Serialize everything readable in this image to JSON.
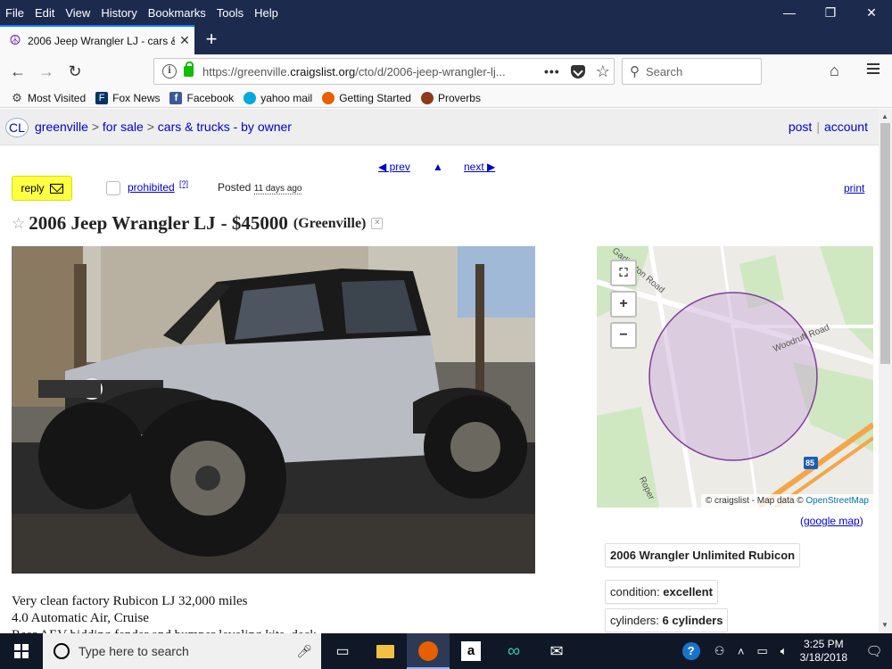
{
  "menu": [
    "File",
    "Edit",
    "View",
    "History",
    "Bookmarks",
    "Tools",
    "Help"
  ],
  "window_controls": {
    "minimize": "—",
    "restore": "❐",
    "close": "✕"
  },
  "tab": {
    "title": "2006 Jeep Wrangler LJ - cars & t",
    "close": "✕"
  },
  "newtab": "+",
  "nav": {
    "back": "←",
    "forward": "→",
    "reload": "↻"
  },
  "url": {
    "prefix": "https://greenville.",
    "domain": "craigslist.org",
    "path": "/cto/d/2006-jeep-wrangler-lj..."
  },
  "search": {
    "placeholder": "Search"
  },
  "bookmarks": [
    {
      "label": "Most Visited",
      "icon": "gear-icon",
      "color": "#444"
    },
    {
      "label": "Fox News",
      "icon": "foxnews-icon",
      "color": "#003366"
    },
    {
      "label": "Facebook",
      "icon": "facebook-icon",
      "color": "#3b5998"
    },
    {
      "label": "yahoo mail",
      "icon": "att-icon",
      "color": "#00a8e0"
    },
    {
      "label": "Getting Started",
      "icon": "firefox-icon",
      "color": "#e66000"
    },
    {
      "label": "Proverbs",
      "icon": "book-icon",
      "color": "#8b3a1a"
    }
  ],
  "craigslist": {
    "logo": "CL",
    "crumbs": [
      "greenville",
      "for sale",
      "cars & trucks - by owner"
    ],
    "crumb_sep": ">",
    "post": "post",
    "account": "account"
  },
  "pager": {
    "prev": "◀ prev",
    "up": "▲",
    "next": "next ▶"
  },
  "reply": "reply",
  "prohibited": "prohibited",
  "prohibited_help": "[?]",
  "posted": {
    "label": "Posted",
    "ago": "11 days ago"
  },
  "print": "print",
  "listing": {
    "title": "2006 Jeep Wrangler LJ",
    "price": "- $45000",
    "location": "(Greenville)"
  },
  "map": {
    "attribution": "© craigslist - Map data ©",
    "osm": "OpenStreetMap",
    "road1": "Woodruff Road",
    "road2": "Garlington Road",
    "road3": "Roper",
    "interstate": "85",
    "google_link": "google map"
  },
  "attributes": {
    "model": "2006 Wrangler Unlimited Rubicon",
    "condition_label": "condition:",
    "condition_value": "excellent",
    "cylinders_label": "cylinders:",
    "cylinders_value": "6 cylinders"
  },
  "body": [
    "Very clean factory Rubicon LJ 32,000 miles",
    "4.0 Automatic Air, Cruise",
    "Rear AEV bidding fender and bumper leveling kits, deck"
  ],
  "taskbar": {
    "search_placeholder": "Type here to search",
    "time": "3:25 PM",
    "date": "3/18/2018"
  }
}
